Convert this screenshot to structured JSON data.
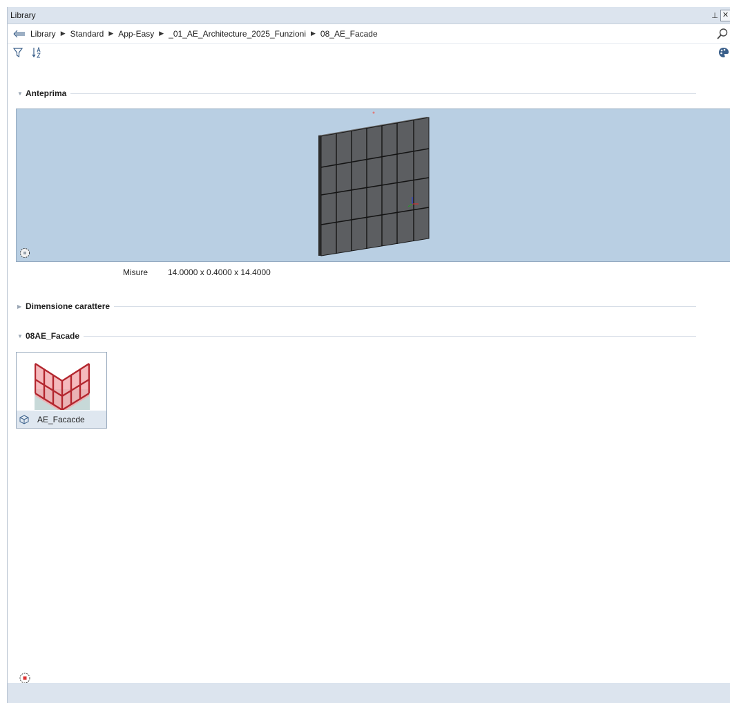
{
  "window": {
    "title": "Library",
    "pin_glyph": "⊥",
    "close_glyph": "✕"
  },
  "breadcrumb": {
    "items": [
      "Library",
      "Standard",
      "App-Easy",
      "_01_AE_Architecture_2025_Funzioni",
      "08_AE_Facade"
    ],
    "separator": "▶"
  },
  "toolbar": {
    "icons": [
      "filter-icon",
      "sort-az-icon",
      "palette-icon"
    ]
  },
  "sections": {
    "preview": {
      "label": "Anteprima",
      "caret": "▼"
    },
    "font_size": {
      "label": "Dimensione carattere",
      "caret": "▶"
    },
    "folder": {
      "label": "08AE_Facade",
      "caret": "▼"
    }
  },
  "preview_info": {
    "key": "Misure",
    "value": "14.0000 x 0.4000 x 14.4000"
  },
  "items": [
    {
      "name": "AE_Facacde"
    }
  ],
  "colors": {
    "accent": "#b9cfe3",
    "facade_red": "#b3262e",
    "panel": "#dce4ee"
  }
}
